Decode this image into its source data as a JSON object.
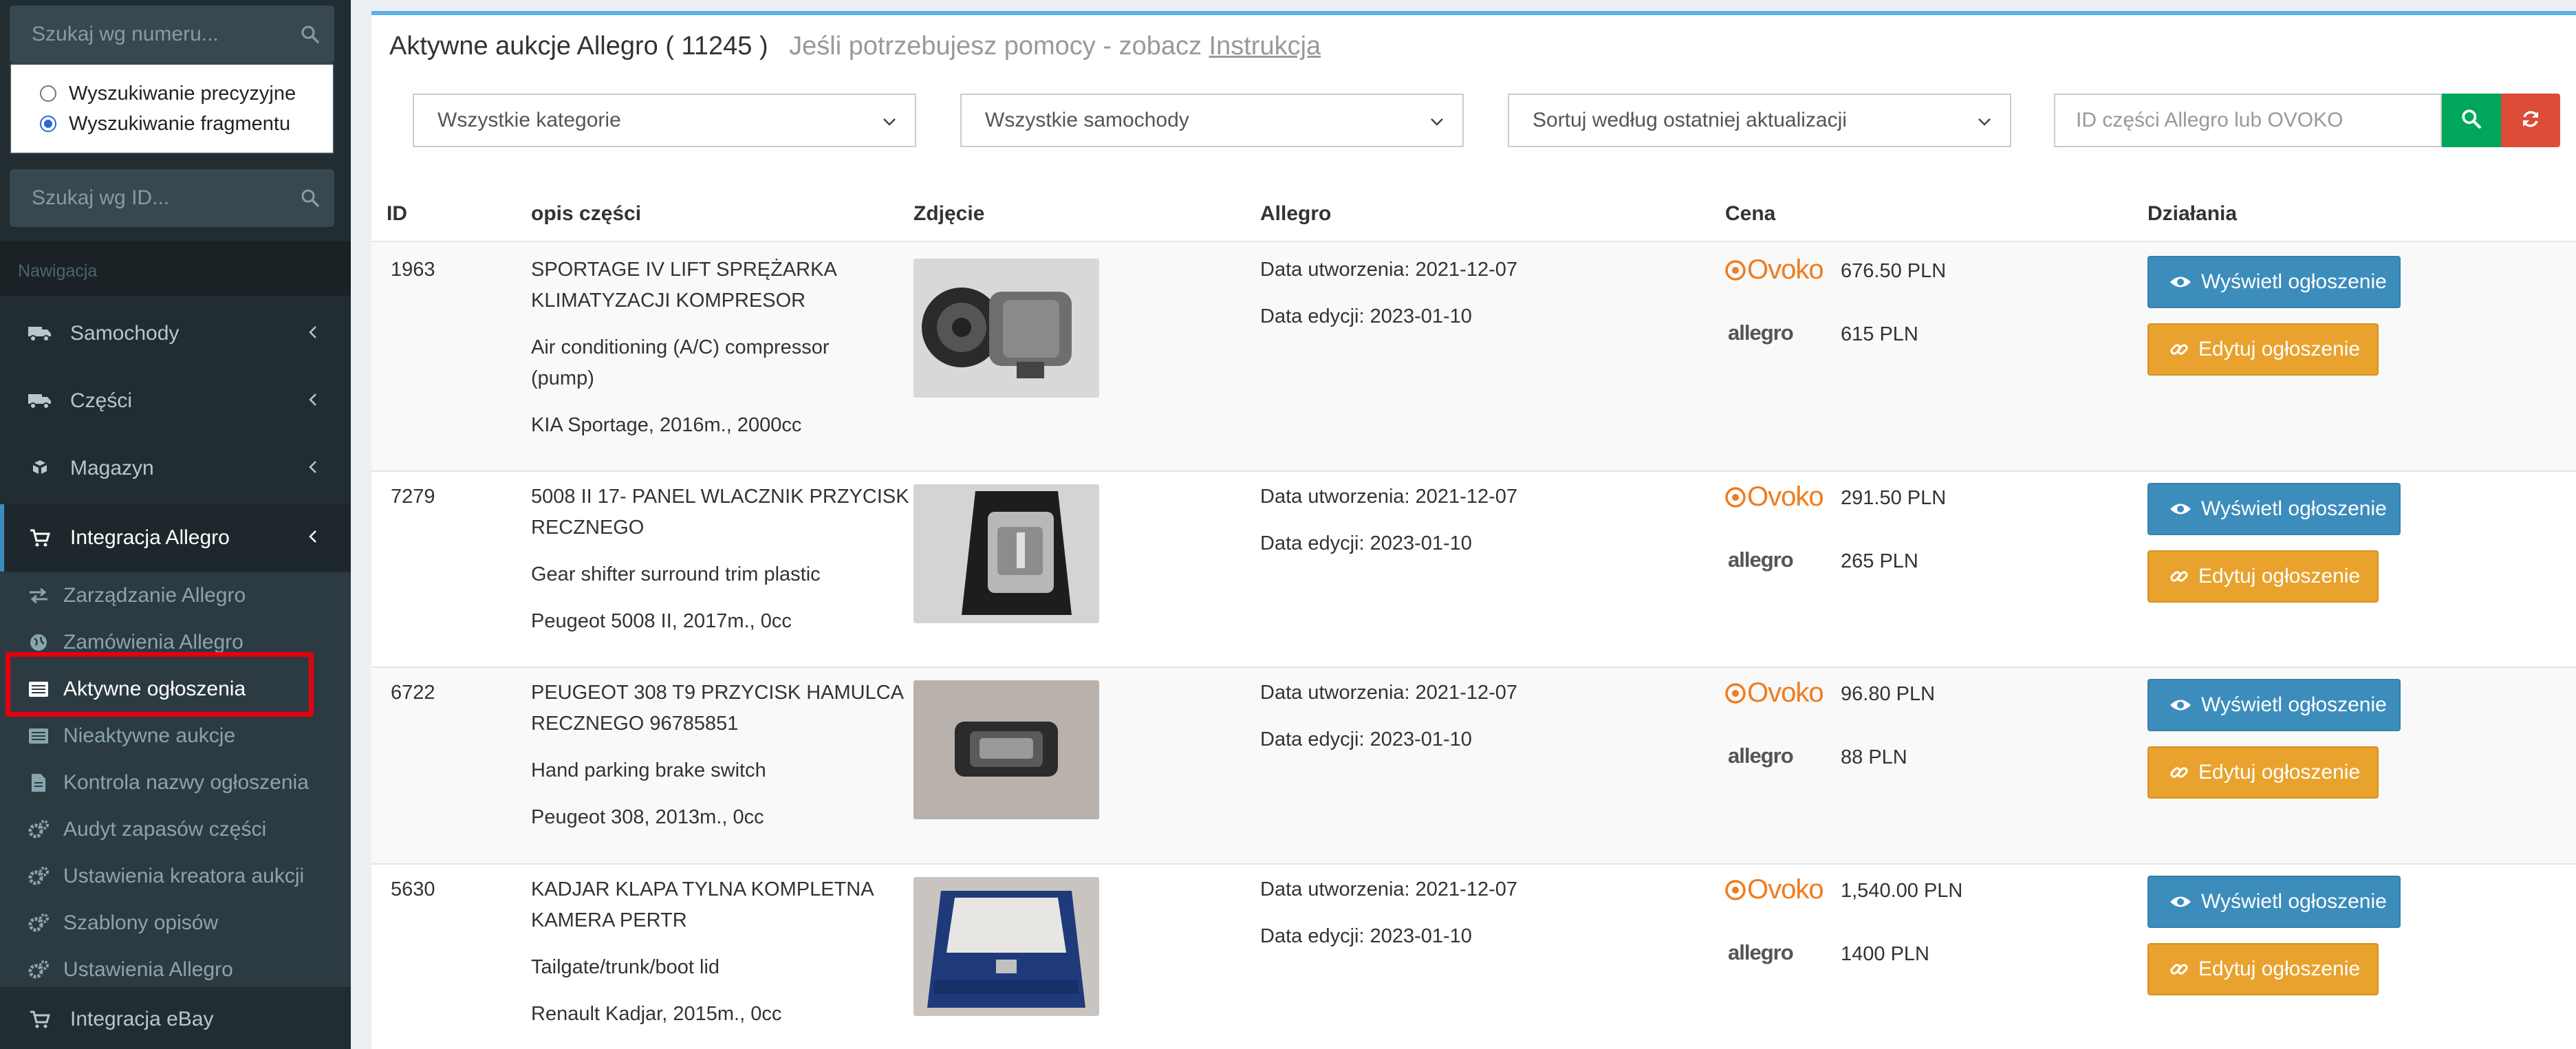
{
  "sidebar": {
    "search_number_placeholder": "Szukaj wg numeru...",
    "radio_precise": "Wyszukiwanie precyzyjne",
    "radio_fragment": "Wyszukiwanie fragmentu",
    "radio_selected": "fragment",
    "search_id_placeholder": "Szukaj wg ID...",
    "nav_header": "Nawigacja",
    "items": [
      {
        "label": "Samochody",
        "icon": "truck-icon"
      },
      {
        "label": "Części",
        "icon": "truck-icon"
      },
      {
        "label": "Magazyn",
        "icon": "boxes-icon"
      },
      {
        "label": "Integracja Allegro",
        "icon": "cart-icon"
      }
    ],
    "submenu": [
      {
        "label": "Zarządzanie Allegro",
        "icon": "exchange-icon"
      },
      {
        "label": "Zamówienia Allegro",
        "icon": "globe-icon"
      },
      {
        "label": "Aktywne ogłoszenia",
        "icon": "list-icon"
      },
      {
        "label": "Nieaktywne aukcje",
        "icon": "list-icon"
      },
      {
        "label": "Kontrola nazwy ogłoszenia",
        "icon": "file-icon"
      },
      {
        "label": "Audyt zapasów części",
        "icon": "cogs-icon"
      },
      {
        "label": "Ustawienia kreatora aukcji",
        "icon": "cogs-icon"
      },
      {
        "label": "Szablony opisów",
        "icon": "cogs-icon"
      },
      {
        "label": "Ustawienia Allegro",
        "icon": "cogs-icon"
      }
    ],
    "bottom_item": {
      "label": "Integracja eBay",
      "icon": "cart-icon"
    }
  },
  "main": {
    "title": "Aktywne aukcje Allegro ( 11245 )",
    "help_text": "Jeśli potrzebujesz pomocy - zobacz",
    "help_link": "Instrukcja",
    "filters": {
      "category": "Wszystkie kategorie",
      "car": "Wszystkie samochody",
      "sort": "Sortuj według ostatniej aktualizacji",
      "id_placeholder": "ID części Allegro lub OVOKO"
    },
    "headers": [
      "ID",
      "opis części",
      "Zdjęcie",
      "Allegro",
      "Cena",
      "Działania"
    ],
    "ovoko_label": "Ovoko",
    "allegro_label": "allegro",
    "view_button": "Wyświetl ogłoszenie",
    "edit_button": "Edytuj ogłoszenie",
    "rows": [
      {
        "id": "1963",
        "title_line1": "SPORTAGE IV LIFT SPRĘŻARKA",
        "title_line2": "KLIMATYZACJI KOMPRESOR",
        "desc_line1": "Air conditioning (A/C) compressor",
        "desc_line2": "(pump)",
        "car": "KIA Sportage, 2016m., 2000cc",
        "created": "Data utworzenia: 2021-12-07",
        "edited": "Data edycji: 2023-01-10",
        "ovoko_price": "676.50 PLN",
        "allegro_price": "615 PLN"
      },
      {
        "id": "7279",
        "title_line1": "5008 II 17- PANEL WLACZNIK PRZYCISK",
        "title_line2": "RECZNEGO",
        "desc_line1": "Gear shifter surround trim plastic",
        "desc_line2": "",
        "car": "Peugeot 5008 II, 2017m., 0cc",
        "created": "Data utworzenia: 2021-12-07",
        "edited": "Data edycji: 2023-01-10",
        "ovoko_price": "291.50 PLN",
        "allegro_price": "265 PLN"
      },
      {
        "id": "6722",
        "title_line1": "PEUGEOT 308 T9 PRZYCISK HAMULCA",
        "title_line2": "RECZNEGO 96785851",
        "desc_line1": "Hand parking brake switch",
        "desc_line2": "",
        "car": "Peugeot 308, 2013m., 0cc",
        "created": "Data utworzenia: 2021-12-07",
        "edited": "Data edycji: 2023-01-10",
        "ovoko_price": "96.80 PLN",
        "allegro_price": "88 PLN"
      },
      {
        "id": "5630",
        "title_line1": "KADJAR KLAPA TYLNA KOMPLETNA",
        "title_line2": "KAMERA PERTR",
        "desc_line1": "Tailgate/trunk/boot lid",
        "desc_line2": "",
        "car": "Renault Kadjar, 2015m., 0cc",
        "created": "Data utworzenia: 2021-12-07",
        "edited": "Data edycji: 2023-01-10",
        "ovoko_price": "1,540.00 PLN",
        "allegro_price": "1400 PLN"
      }
    ]
  }
}
